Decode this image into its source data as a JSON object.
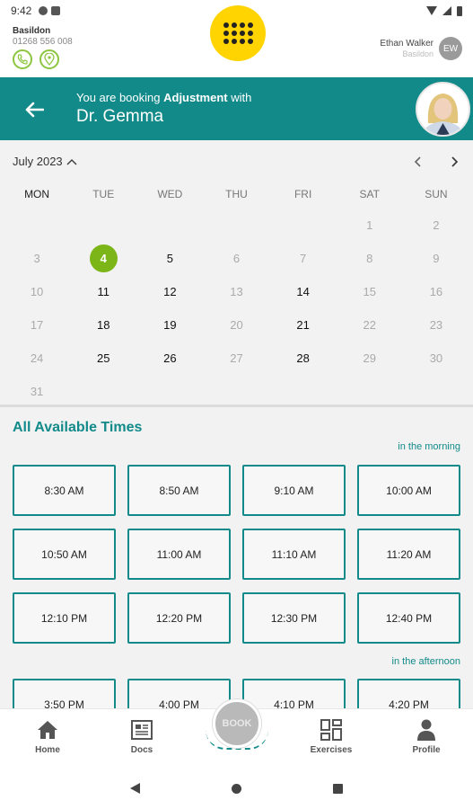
{
  "status_bar": {
    "time": "9:42"
  },
  "header": {
    "clinic_name": "Basildon",
    "clinic_phone": "01268 556 008",
    "user_name": "Ethan Walker",
    "user_location": "Basildon",
    "user_initials": "EW"
  },
  "banner": {
    "prefix": "You are booking ",
    "service": "Adjustment",
    "suffix": " with",
    "doctor": "Dr. Gemma"
  },
  "calendar": {
    "month": "July 2023",
    "weekdays": [
      "MON",
      "TUE",
      "WED",
      "THU",
      "FRI",
      "SAT",
      "SUN"
    ],
    "leading_blanks": 5,
    "days": [
      {
        "d": "1",
        "s": "u"
      },
      {
        "d": "2",
        "s": "u"
      },
      {
        "d": "3",
        "s": "u"
      },
      {
        "d": "4",
        "s": "sel"
      },
      {
        "d": "5",
        "s": "a"
      },
      {
        "d": "6",
        "s": "u"
      },
      {
        "d": "7",
        "s": "u"
      },
      {
        "d": "8",
        "s": "u"
      },
      {
        "d": "9",
        "s": "u"
      },
      {
        "d": "10",
        "s": "u"
      },
      {
        "d": "11",
        "s": "a"
      },
      {
        "d": "12",
        "s": "a"
      },
      {
        "d": "13",
        "s": "u"
      },
      {
        "d": "14",
        "s": "a"
      },
      {
        "d": "15",
        "s": "u"
      },
      {
        "d": "16",
        "s": "u"
      },
      {
        "d": "17",
        "s": "u"
      },
      {
        "d": "18",
        "s": "a"
      },
      {
        "d": "19",
        "s": "a"
      },
      {
        "d": "20",
        "s": "u"
      },
      {
        "d": "21",
        "s": "a"
      },
      {
        "d": "22",
        "s": "u"
      },
      {
        "d": "23",
        "s": "u"
      },
      {
        "d": "24",
        "s": "u"
      },
      {
        "d": "25",
        "s": "a"
      },
      {
        "d": "26",
        "s": "a"
      },
      {
        "d": "27",
        "s": "u"
      },
      {
        "d": "28",
        "s": "a"
      },
      {
        "d": "29",
        "s": "u"
      },
      {
        "d": "30",
        "s": "u"
      },
      {
        "d": "31",
        "s": "u"
      }
    ]
  },
  "times": {
    "title": "All Available Times",
    "morning_label": "in the morning",
    "morning": [
      "8:30 AM",
      "8:50 AM",
      "9:10 AM",
      "10:00 AM",
      "10:50 AM",
      "11:00 AM",
      "11:10 AM",
      "11:20 AM",
      "12:10 PM",
      "12:20 PM",
      "12:30 PM",
      "12:40 PM"
    ],
    "afternoon_label": "in the afternoon",
    "afternoon": [
      "3:50 PM",
      "4:00 PM",
      "4:10 PM",
      "4:20 PM"
    ]
  },
  "bottom_nav": {
    "home": "Home",
    "docs": "Docs",
    "book": "BOOK",
    "exercises": "Exercises",
    "profile": "Profile"
  },
  "colors": {
    "teal": "#138a8a",
    "selected_day": "#7cb518",
    "logo_yellow": "#ffd400"
  }
}
